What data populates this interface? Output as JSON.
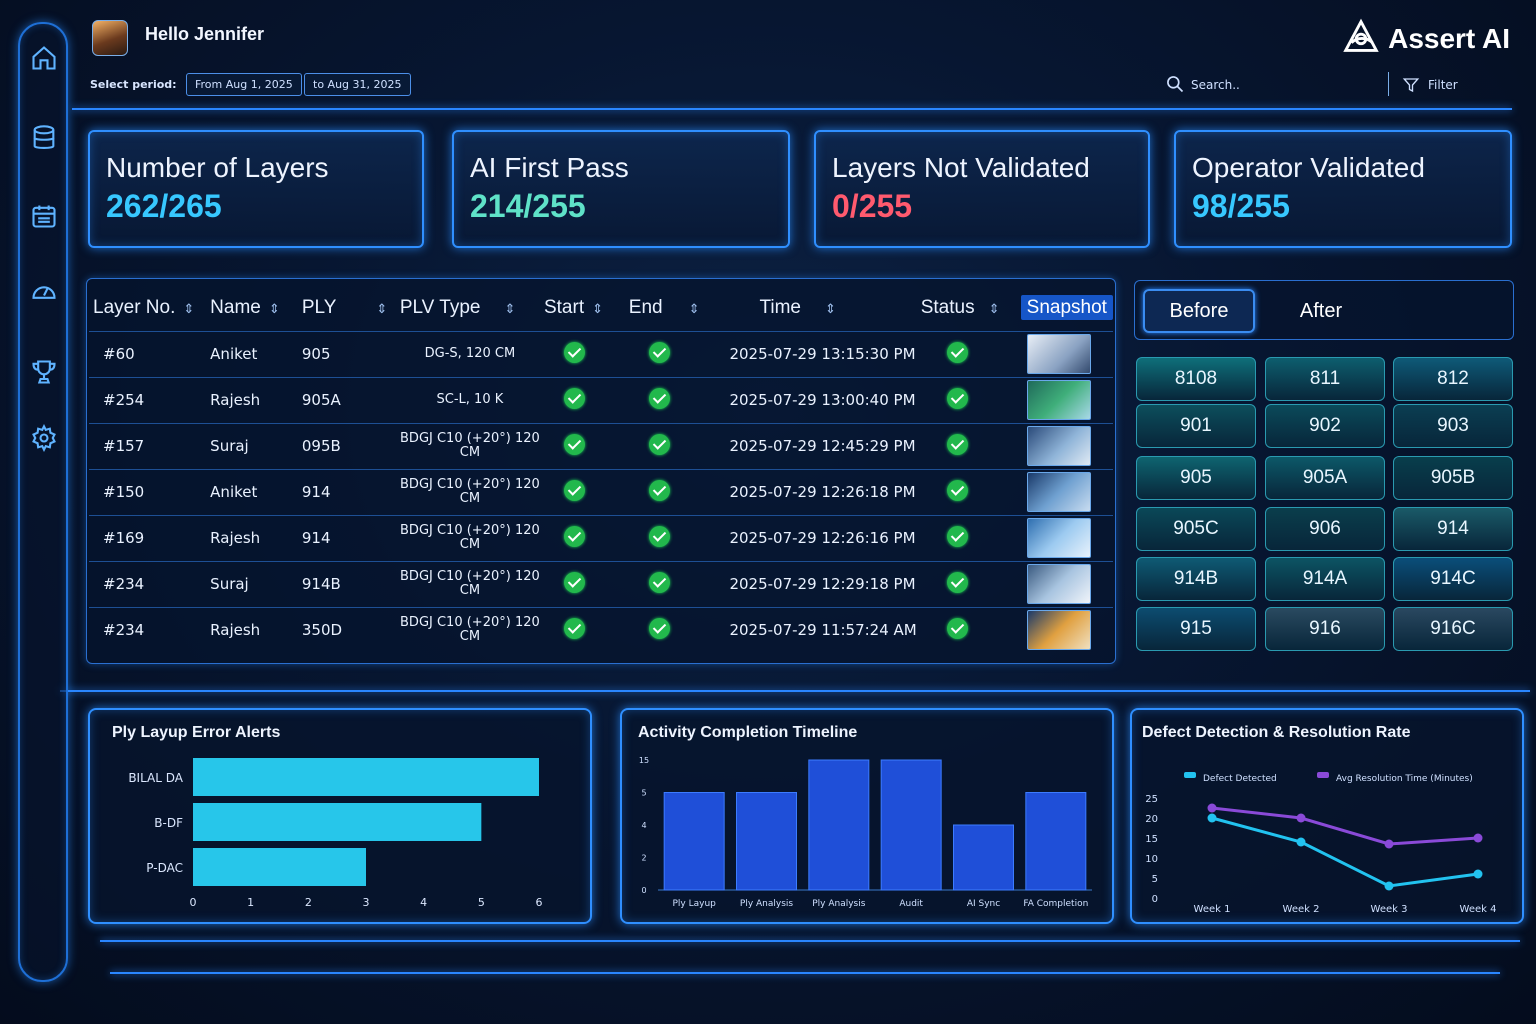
{
  "header": {
    "greeting": "Hello Jennifer",
    "brand": "Assert AI"
  },
  "period": {
    "label": "Select period:",
    "from": "From Aug 1, 2025",
    "to": "to Aug 31, 2025"
  },
  "search": {
    "placeholder": "Search.."
  },
  "filter": {
    "label": "Filter"
  },
  "sidebar": {
    "icons": [
      "home-icon",
      "database-icon",
      "calendar-icon",
      "gauge-icon",
      "trophy-icon",
      "gear-icon"
    ]
  },
  "kpis": [
    {
      "title": "Number of Layers",
      "value": "262/265",
      "color": "#37c8ff"
    },
    {
      "title": "AI First Pass",
      "value": "214/255",
      "color": "#5fe2c8"
    },
    {
      "title": "Layers Not Validated",
      "value": "0/255",
      "color": "#ff5a6e"
    },
    {
      "title": "Operator Validated",
      "value": "98/255",
      "color": "#37c8ff"
    }
  ],
  "table": {
    "headers": [
      "Layer No.",
      "Name",
      "PLY",
      "PLV Type",
      "Start",
      "End",
      "Time",
      "Status",
      "Snapshot"
    ],
    "rows": [
      {
        "layer": "#60",
        "name": "Aniket",
        "ply": "905",
        "plv": "DG-S, 120 CM",
        "time": "2025-07-29 13:15:30 PM"
      },
      {
        "layer": "#254",
        "name": "Rajesh",
        "ply": "905A",
        "plv": "SC-L, 10 K",
        "time": "2025-07-29 13:00:40 PM"
      },
      {
        "layer": "#157",
        "name": "Suraj",
        "ply": "095B",
        "plv": "BDGJ C10 (+20°) 120 CM",
        "time": "2025-07-29 12:45:29 PM"
      },
      {
        "layer": "#150",
        "name": "Aniket",
        "ply": "914",
        "plv": "BDGJ C10 (+20°) 120 CM",
        "time": "2025-07-29 12:26:18 PM"
      },
      {
        "layer": "#169",
        "name": "Rajesh",
        "ply": "914",
        "plv": "BDGJ C10 (+20°) 120 CM",
        "time": "2025-07-29 12:26:16 PM"
      },
      {
        "layer": "#234",
        "name": "Suraj",
        "ply": "914B",
        "plv": "BDGJ C10 (+20°) 120 CM",
        "time": "2025-07-29 12:29:18 PM"
      },
      {
        "layer": "#234",
        "name": "Rajesh",
        "ply": "350D",
        "plv": "BDGJ C10 (+20°) 120 CM",
        "time": "2025-07-29 11:57:24 AM"
      }
    ]
  },
  "before_after": {
    "tabs": [
      "Before",
      "After"
    ],
    "plies": [
      "8108",
      "811",
      "812",
      "901",
      "902",
      "903",
      "905",
      "905A",
      "905B",
      "905C",
      "906",
      "914",
      "914B",
      "914A",
      "914C",
      "915",
      "916",
      "916C"
    ]
  },
  "chart_data": [
    {
      "type": "bar",
      "orientation": "horizontal",
      "title": "Ply Layup Error Alerts",
      "categories": [
        "BILAL DA",
        "B-DF",
        "P-DAC"
      ],
      "values": [
        6,
        5,
        3
      ],
      "xticks": [
        "0",
        "1",
        "2",
        "3",
        "4",
        "5",
        "6"
      ],
      "xlim": [
        0,
        6
      ]
    },
    {
      "type": "bar",
      "title": "Activity Completion Timeline",
      "categories": [
        "Ply Layup",
        "Ply Analysis",
        "Ply Analysis",
        "Audit",
        "AI Sync",
        "FA Completion"
      ],
      "values": [
        6,
        6,
        8,
        8,
        4,
        6
      ],
      "yticks": [
        "0",
        "2",
        "4",
        "5",
        "15"
      ],
      "ylim": [
        0,
        8
      ]
    },
    {
      "type": "line",
      "title": "Defect Detection & Resolution Rate",
      "categories": [
        "Week 1",
        "Week 2",
        "Week 3",
        "Week 4"
      ],
      "series": [
        {
          "name": "Defect Detected",
          "values": [
            20,
            14,
            3,
            6
          ],
          "color": "#22c3f0"
        },
        {
          "name": "Avg Resolution Time (Minutes)",
          "values": [
            22.5,
            20,
            13.5,
            15
          ],
          "color": "#8a4ad8"
        }
      ],
      "yticks": [
        "0",
        "5",
        "10",
        "15",
        "20",
        "25"
      ],
      "ylim": [
        0,
        25
      ],
      "legend": "top"
    }
  ]
}
